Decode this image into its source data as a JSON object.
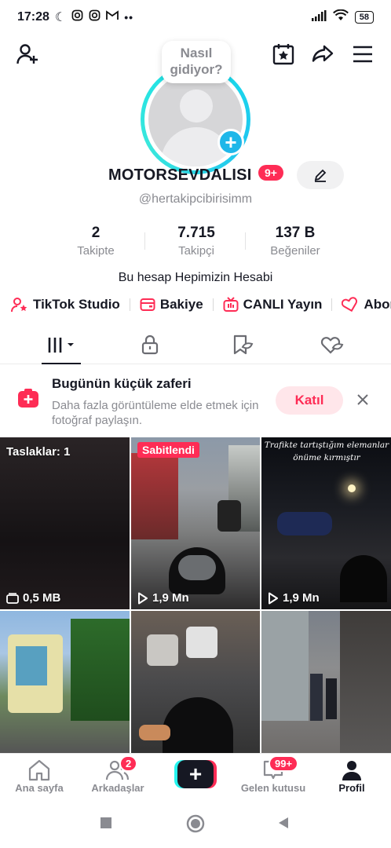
{
  "status_bar": {
    "time": "17:28",
    "battery": "58"
  },
  "profile": {
    "bubble_text": "Nasıl gidiyor?",
    "username": "MOTORSEVDALISI",
    "notification_badge": "9+",
    "handle": "@hertakipcibirisimm",
    "bio": "Bu hesap Hepimizin Hesabi"
  },
  "stats": [
    {
      "value": "2",
      "label": "Takipte"
    },
    {
      "value": "7.715",
      "label": "Takipçi"
    },
    {
      "value": "137 B",
      "label": "Beğeniler"
    }
  ],
  "links": [
    {
      "label": "TikTok Studio",
      "icon": "person-star-icon"
    },
    {
      "label": "Bakiye",
      "icon": "wallet-icon"
    },
    {
      "label": "CANLI Yayın",
      "icon": "live-tv-icon"
    },
    {
      "label": "Abon",
      "icon": "subscription-heart-icon"
    }
  ],
  "tabs": [
    {
      "name": "videos-grid-icon"
    },
    {
      "name": "lock-icon"
    },
    {
      "name": "saved-bookmark-icon"
    },
    {
      "name": "liked-heart-icon"
    }
  ],
  "banner": {
    "title": "Bugünün küçük zaferi",
    "description": "Daha fazla görüntüleme elde etmek için fotoğraf paylaşın.",
    "button": "Katıl"
  },
  "grid": {
    "drafts_label": "Taslaklar: 1",
    "drafts_size": "0,5 MB",
    "pinned_label": "Sabitlendi",
    "video1_views": "1,9 Mn",
    "video2_views": "1,9 Mn",
    "video2_caption_line1": "Trafikte tartıştığım elemanlar",
    "video2_caption_line2": "önüme kırmıştır"
  },
  "bottom_nav": {
    "home": "Ana sayfa",
    "friends": "Arkadaşlar",
    "friends_badge": "2",
    "inbox": "Gelen kutusu",
    "inbox_badge": "99+",
    "profile": "Profil"
  },
  "colors": {
    "accent": "#fe2c55",
    "cyan": "#25f4ee",
    "ring": "#1fc6f0"
  }
}
